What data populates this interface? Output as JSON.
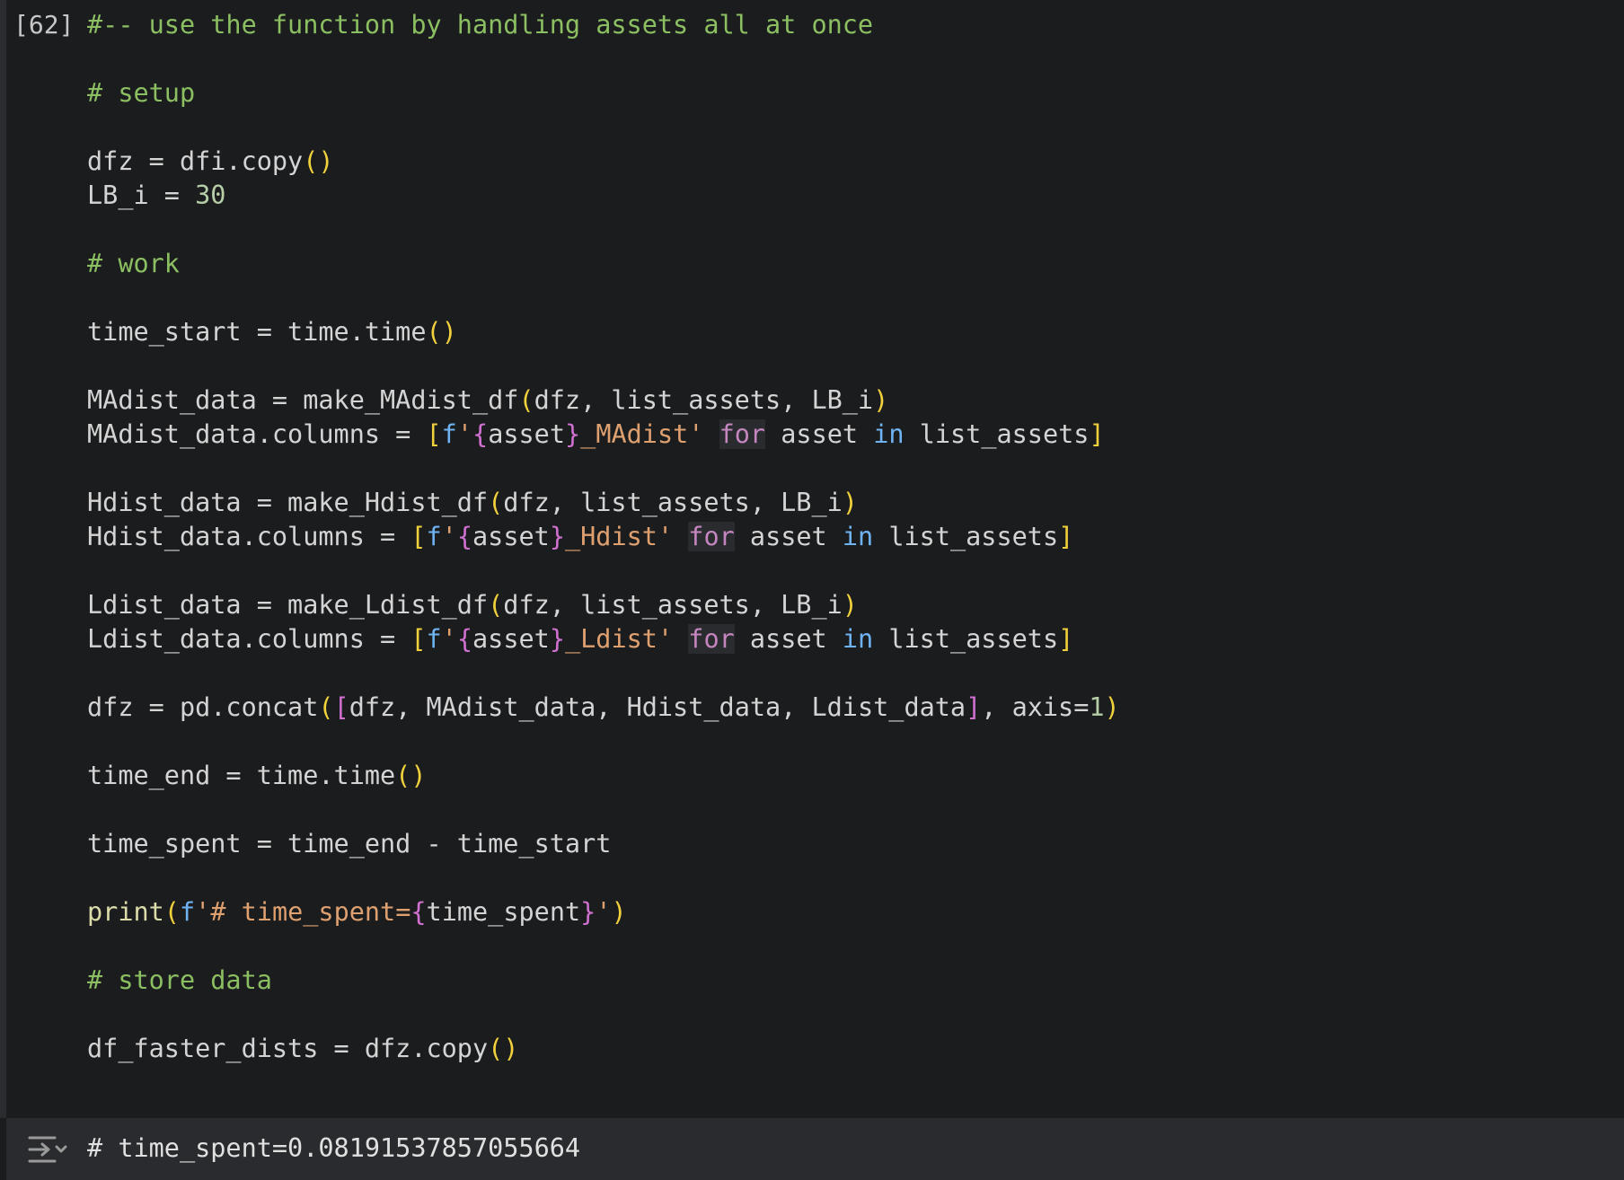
{
  "cell": {
    "execution_count": "[62]",
    "code_lines": [
      "#-- use the function by handling assets all at once",
      "",
      "# setup",
      "",
      "dfz = dfi.copy()",
      "LB_i = 30",
      "",
      "# work",
      "",
      "time_start = time.time()",
      "",
      "MAdist_data = make_MAdist_df(dfz, list_assets, LB_i)",
      "MAdist_data.columns = [f'{asset}_MAdist' for asset in list_assets]",
      "",
      "Hdist_data = make_Hdist_df(dfz, list_assets, LB_i)",
      "Hdist_data.columns = [f'{asset}_Hdist' for asset in list_assets]",
      "",
      "Ldist_data = make_Ldist_df(dfz, list_assets, LB_i)",
      "Ldist_data.columns = [f'{asset}_Ldist' for asset in list_assets]",
      "",
      "dfz = pd.concat([dfz, MAdist_data, Hdist_data, Ldist_data], axis=1)",
      "",
      "time_end = time.time()",
      "",
      "time_spent = time_end - time_start",
      "",
      "print(f'# time_spent={time_spent}')",
      "",
      "# store data",
      "",
      "df_faster_dists = dfz.copy()"
    ]
  },
  "output": {
    "icon": "output-toggle-icon",
    "text": "# time_spent=0.08191537857055664"
  },
  "colors": {
    "background": "#1b1c1e",
    "output_background": "#2a2b2e",
    "comment": "#8bbf61",
    "keyword": "#c586c0",
    "in_keyword": "#6fb3f2",
    "string": "#dfa070",
    "number": "#b5cea8",
    "paren_yellow": "#f0d03b",
    "paren_purple": "#d070d0"
  }
}
